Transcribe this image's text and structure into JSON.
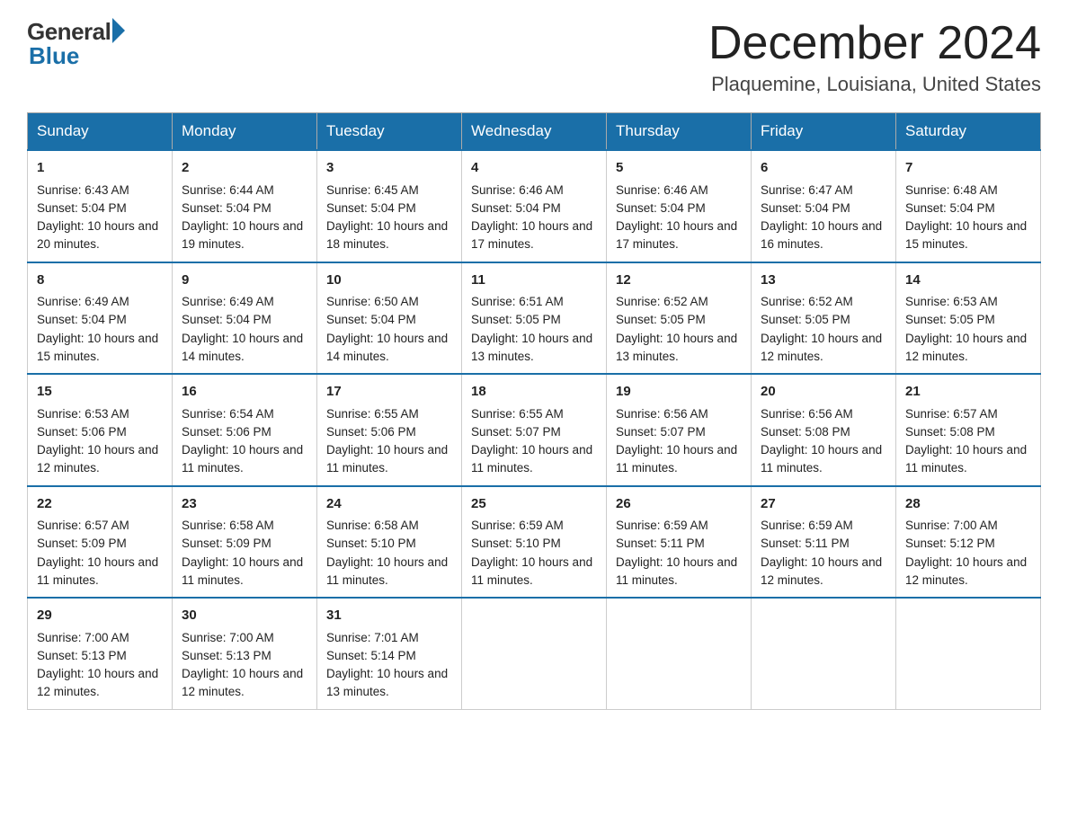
{
  "header": {
    "title": "December 2024",
    "location": "Plaquemine, Louisiana, United States",
    "logo_general": "General",
    "logo_blue": "Blue"
  },
  "weekdays": [
    "Sunday",
    "Monday",
    "Tuesday",
    "Wednesday",
    "Thursday",
    "Friday",
    "Saturday"
  ],
  "weeks": [
    [
      {
        "day": "1",
        "sunrise": "6:43 AM",
        "sunset": "5:04 PM",
        "daylight": "10 hours and 20 minutes."
      },
      {
        "day": "2",
        "sunrise": "6:44 AM",
        "sunset": "5:04 PM",
        "daylight": "10 hours and 19 minutes."
      },
      {
        "day": "3",
        "sunrise": "6:45 AM",
        "sunset": "5:04 PM",
        "daylight": "10 hours and 18 minutes."
      },
      {
        "day": "4",
        "sunrise": "6:46 AM",
        "sunset": "5:04 PM",
        "daylight": "10 hours and 17 minutes."
      },
      {
        "day": "5",
        "sunrise": "6:46 AM",
        "sunset": "5:04 PM",
        "daylight": "10 hours and 17 minutes."
      },
      {
        "day": "6",
        "sunrise": "6:47 AM",
        "sunset": "5:04 PM",
        "daylight": "10 hours and 16 minutes."
      },
      {
        "day": "7",
        "sunrise": "6:48 AM",
        "sunset": "5:04 PM",
        "daylight": "10 hours and 15 minutes."
      }
    ],
    [
      {
        "day": "8",
        "sunrise": "6:49 AM",
        "sunset": "5:04 PM",
        "daylight": "10 hours and 15 minutes."
      },
      {
        "day": "9",
        "sunrise": "6:49 AM",
        "sunset": "5:04 PM",
        "daylight": "10 hours and 14 minutes."
      },
      {
        "day": "10",
        "sunrise": "6:50 AM",
        "sunset": "5:04 PM",
        "daylight": "10 hours and 14 minutes."
      },
      {
        "day": "11",
        "sunrise": "6:51 AM",
        "sunset": "5:05 PM",
        "daylight": "10 hours and 13 minutes."
      },
      {
        "day": "12",
        "sunrise": "6:52 AM",
        "sunset": "5:05 PM",
        "daylight": "10 hours and 13 minutes."
      },
      {
        "day": "13",
        "sunrise": "6:52 AM",
        "sunset": "5:05 PM",
        "daylight": "10 hours and 12 minutes."
      },
      {
        "day": "14",
        "sunrise": "6:53 AM",
        "sunset": "5:05 PM",
        "daylight": "10 hours and 12 minutes."
      }
    ],
    [
      {
        "day": "15",
        "sunrise": "6:53 AM",
        "sunset": "5:06 PM",
        "daylight": "10 hours and 12 minutes."
      },
      {
        "day": "16",
        "sunrise": "6:54 AM",
        "sunset": "5:06 PM",
        "daylight": "10 hours and 11 minutes."
      },
      {
        "day": "17",
        "sunrise": "6:55 AM",
        "sunset": "5:06 PM",
        "daylight": "10 hours and 11 minutes."
      },
      {
        "day": "18",
        "sunrise": "6:55 AM",
        "sunset": "5:07 PM",
        "daylight": "10 hours and 11 minutes."
      },
      {
        "day": "19",
        "sunrise": "6:56 AM",
        "sunset": "5:07 PM",
        "daylight": "10 hours and 11 minutes."
      },
      {
        "day": "20",
        "sunrise": "6:56 AM",
        "sunset": "5:08 PM",
        "daylight": "10 hours and 11 minutes."
      },
      {
        "day": "21",
        "sunrise": "6:57 AM",
        "sunset": "5:08 PM",
        "daylight": "10 hours and 11 minutes."
      }
    ],
    [
      {
        "day": "22",
        "sunrise": "6:57 AM",
        "sunset": "5:09 PM",
        "daylight": "10 hours and 11 minutes."
      },
      {
        "day": "23",
        "sunrise": "6:58 AM",
        "sunset": "5:09 PM",
        "daylight": "10 hours and 11 minutes."
      },
      {
        "day": "24",
        "sunrise": "6:58 AM",
        "sunset": "5:10 PM",
        "daylight": "10 hours and 11 minutes."
      },
      {
        "day": "25",
        "sunrise": "6:59 AM",
        "sunset": "5:10 PM",
        "daylight": "10 hours and 11 minutes."
      },
      {
        "day": "26",
        "sunrise": "6:59 AM",
        "sunset": "5:11 PM",
        "daylight": "10 hours and 11 minutes."
      },
      {
        "day": "27",
        "sunrise": "6:59 AM",
        "sunset": "5:11 PM",
        "daylight": "10 hours and 12 minutes."
      },
      {
        "day": "28",
        "sunrise": "7:00 AM",
        "sunset": "5:12 PM",
        "daylight": "10 hours and 12 minutes."
      }
    ],
    [
      {
        "day": "29",
        "sunrise": "7:00 AM",
        "sunset": "5:13 PM",
        "daylight": "10 hours and 12 minutes."
      },
      {
        "day": "30",
        "sunrise": "7:00 AM",
        "sunset": "5:13 PM",
        "daylight": "10 hours and 12 minutes."
      },
      {
        "day": "31",
        "sunrise": "7:01 AM",
        "sunset": "5:14 PM",
        "daylight": "10 hours and 13 minutes."
      },
      null,
      null,
      null,
      null
    ]
  ]
}
